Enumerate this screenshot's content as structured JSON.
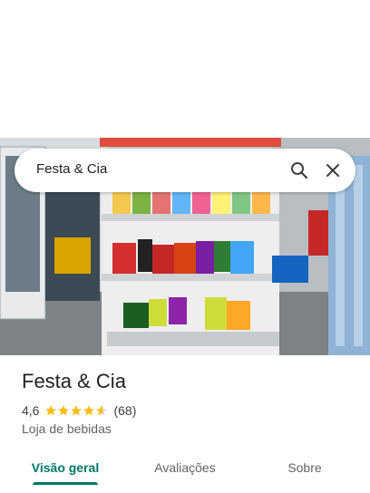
{
  "search": {
    "query": "Festa & Cia",
    "search_icon": "search-icon",
    "close_icon": "close-icon"
  },
  "place": {
    "name": "Festa & Cia",
    "rating": "4,6",
    "rating_value": 4.6,
    "review_count": "(68)",
    "category": "Loja de bebidas"
  },
  "tabs": [
    {
      "label": "Visão geral",
      "active": true
    },
    {
      "label": "Avaliações",
      "active": false
    },
    {
      "label": "Sobre",
      "active": false
    }
  ],
  "colors": {
    "accent": "#00796b",
    "star": "#fbbc04",
    "text_primary": "#202124",
    "text_secondary": "#5f6368"
  }
}
